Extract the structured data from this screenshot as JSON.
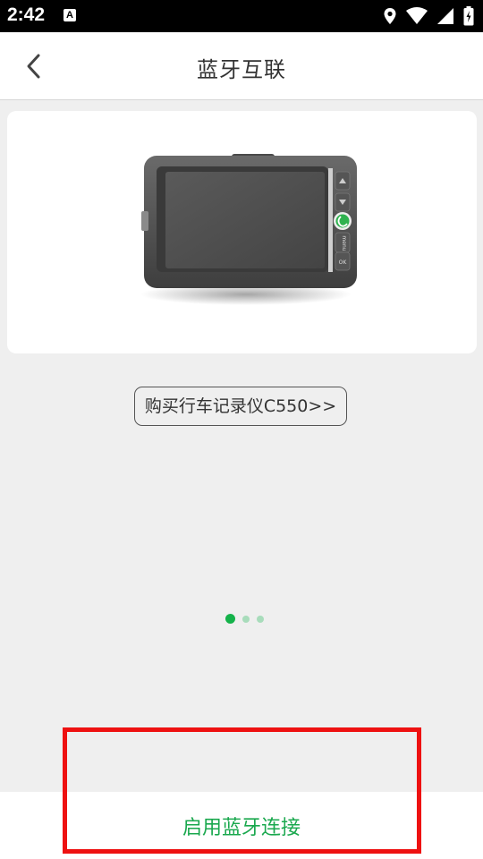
{
  "status_bar": {
    "time": "2:42",
    "notification_glyph": "A",
    "icons": [
      "location-icon",
      "wifi-icon",
      "signal-icon",
      "battery-icon"
    ]
  },
  "app_bar": {
    "back_icon": "chevron-left-icon",
    "title": "蓝牙互联"
  },
  "device": {
    "image": "dashcam-device-illustration",
    "button_labels": [
      "▲",
      "▼",
      "OK"
    ]
  },
  "buy_link": {
    "label": "购买行车记录仪C550>>"
  },
  "pager": {
    "count": 3,
    "active_index": 0
  },
  "bottom": {
    "enable_label": "启用蓝牙连接"
  },
  "colors": {
    "accent": "#1aa84e",
    "dot_active": "#14b24a",
    "dot_inactive": "#a8dcbb",
    "highlight": "#ee1111"
  }
}
